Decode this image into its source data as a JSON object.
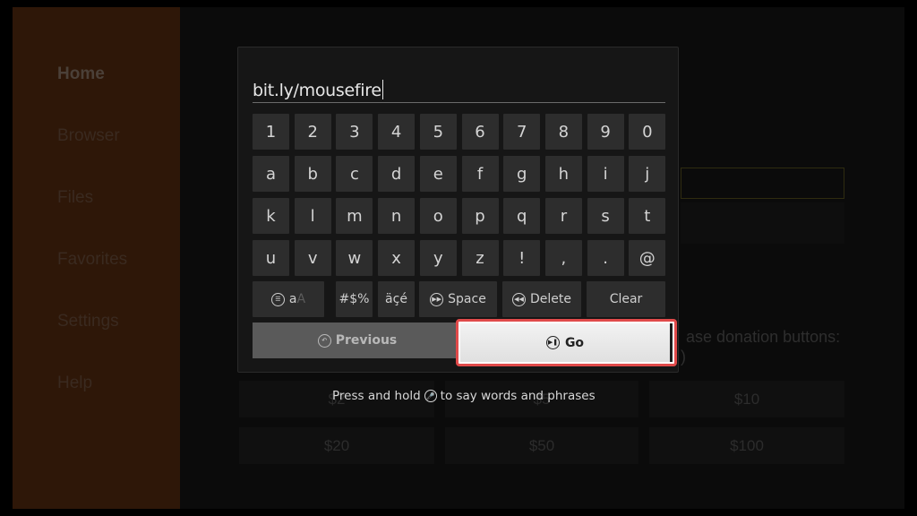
{
  "sidebar": {
    "items": [
      {
        "label": "Home",
        "active": true
      },
      {
        "label": "Browser",
        "active": false
      },
      {
        "label": "Files",
        "active": false
      },
      {
        "label": "Favorites",
        "active": false
      },
      {
        "label": "Settings",
        "active": false
      },
      {
        "label": "Help",
        "active": false
      }
    ]
  },
  "background": {
    "donation_text_line1": "ase donation buttons:",
    "donation_text_line2": ")",
    "donation_buttons": [
      "$2",
      "$5",
      "$10",
      "$20",
      "$50",
      "$100"
    ]
  },
  "keyboard": {
    "input_value": "bit.ly/mousefire",
    "rows": [
      [
        "1",
        "2",
        "3",
        "4",
        "5",
        "6",
        "7",
        "8",
        "9",
        "0"
      ],
      [
        "a",
        "b",
        "c",
        "d",
        "e",
        "f",
        "g",
        "h",
        "i",
        "j"
      ],
      [
        "k",
        "l",
        "m",
        "n",
        "o",
        "p",
        "q",
        "r",
        "s",
        "t"
      ],
      [
        "u",
        "v",
        "w",
        "x",
        "y",
        "z",
        "!",
        ",",
        ".",
        "@"
      ]
    ],
    "special_keys": {
      "case_label_lower": "a",
      "case_label_upper": "A",
      "symbols": "#$%",
      "accents": "äçé",
      "space": "Space",
      "delete": "Delete",
      "clear": "Clear"
    },
    "previous_label": "Previous",
    "go_label": "Go",
    "hint_before": "Press and hold",
    "hint_after": "to say words and phrases"
  },
  "colors": {
    "highlight_border": "#e04a4a",
    "sidebar_bg": "#2e1708"
  }
}
